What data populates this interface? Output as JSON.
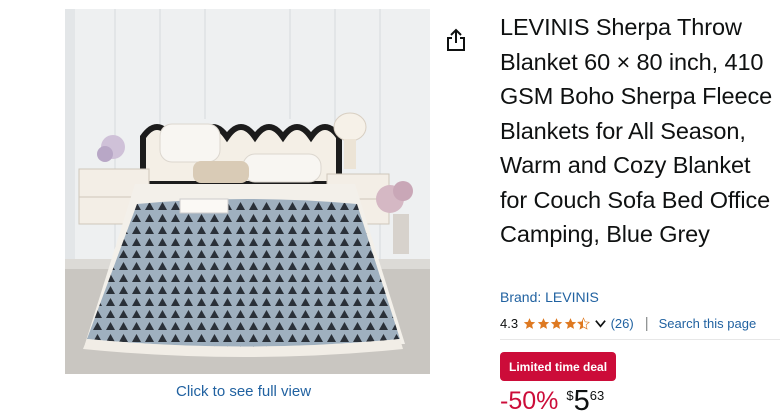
{
  "product": {
    "title": "LEVINIS Sherpa Throw Blanket 60 × 80 inch, 410 GSM Boho Sherpa Fleece Blankets for All Season, Warm and Cozy Blanket for Couch Sofa Bed Office Camping, Blue Grey",
    "brand_label": "Brand: LEVINIS",
    "full_view_label": "Click to see full view",
    "share_icon": "share-icon"
  },
  "rating": {
    "value": "4.3",
    "stars": 4.3,
    "count": "(26)",
    "divider": "|",
    "search_label": "Search this page"
  },
  "deal": {
    "badge_label": "Limited time deal"
  },
  "price": {
    "discount": "-50%",
    "currency": "$",
    "whole": "5",
    "fraction": "63"
  },
  "colors": {
    "link": "#2162a1",
    "deal_red": "#cc0c39",
    "star": "#de7921",
    "text": "#0f1111"
  }
}
